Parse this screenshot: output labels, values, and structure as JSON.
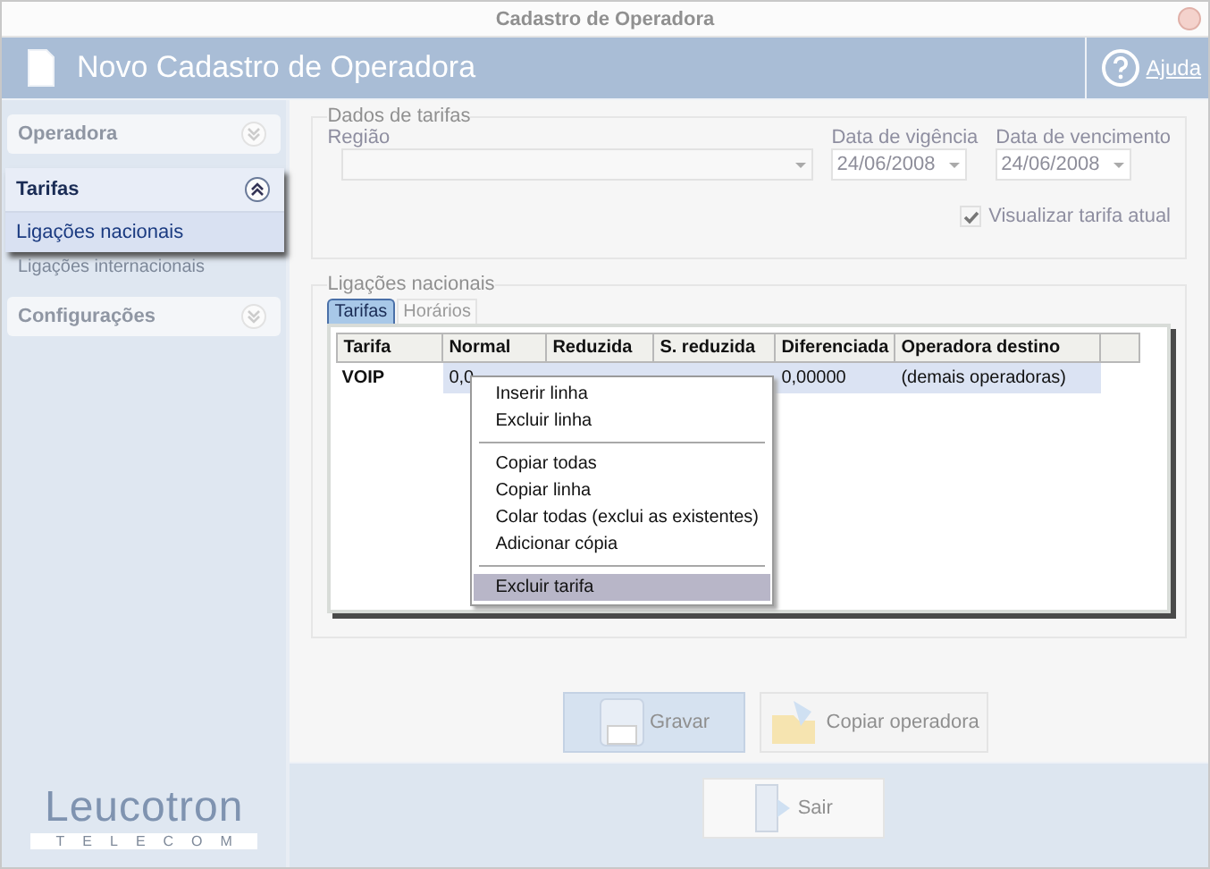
{
  "window": {
    "title": "Cadastro de Operadora"
  },
  "header": {
    "title": "Novo Cadastro de Operadora",
    "help_label": "Ajuda"
  },
  "sidebar": {
    "sections": [
      {
        "label": "Operadora",
        "expanded": false
      },
      {
        "label": "Tarifas",
        "expanded": true,
        "items": [
          {
            "label": "Ligações nacionais",
            "selected": true
          },
          {
            "label": "Ligações internacionais",
            "selected": false
          }
        ]
      },
      {
        "label": "Configurações",
        "expanded": false
      }
    ],
    "logo": {
      "name": "Leucotron",
      "tagline": "TELECOM"
    }
  },
  "dados_de_tarifas": {
    "title": "Dados de tarifas",
    "regiao": {
      "label": "Região",
      "disabled": true
    },
    "data_vigencia": {
      "label": "Data de vigência",
      "value": "24/06/2008"
    },
    "data_vencimento": {
      "label": "Data de vencimento",
      "value": "24/06/2008"
    },
    "visualizar": {
      "label": "Visualizar tarifa atual",
      "checked": true,
      "disabled": true
    }
  },
  "ligacoes_nacionais": {
    "title": "Ligações nacionais",
    "tabs": [
      {
        "label": "Tarifas",
        "selected": true
      },
      {
        "label": "Horários",
        "selected": false
      }
    ],
    "table": {
      "columns": [
        "Tarifa",
        "Normal",
        "Reduzida",
        "S. reduzida",
        "Diferenciada",
        "Operadora destino"
      ],
      "rows": [
        {
          "cells": [
            "VOIP",
            "0,0",
            null,
            null,
            "0,00000",
            "(demais operadoras)"
          ],
          "selected": true
        }
      ]
    },
    "context_menu": [
      {
        "kind": "item",
        "label": "Inserir linha",
        "selected": false
      },
      {
        "kind": "item",
        "label": "Excluir linha",
        "selected": false
      },
      {
        "kind": "separator"
      },
      {
        "kind": "item",
        "label": "Copiar todas",
        "selected": false
      },
      {
        "kind": "item",
        "label": "Copiar linha",
        "selected": false
      },
      {
        "kind": "item",
        "label": "Colar todas (exclui as existentes)",
        "selected": false
      },
      {
        "kind": "item",
        "label": "Adicionar cópia",
        "selected": false
      },
      {
        "kind": "separator"
      },
      {
        "kind": "item",
        "label": "Excluir tarifa",
        "selected": true
      }
    ]
  },
  "buttons": [
    {
      "kind": "save",
      "label": "Gravar",
      "default": true
    },
    {
      "kind": "copy",
      "label": "Copiar operadora",
      "default": false
    }
  ],
  "exit_button": {
    "label": "Sair"
  }
}
